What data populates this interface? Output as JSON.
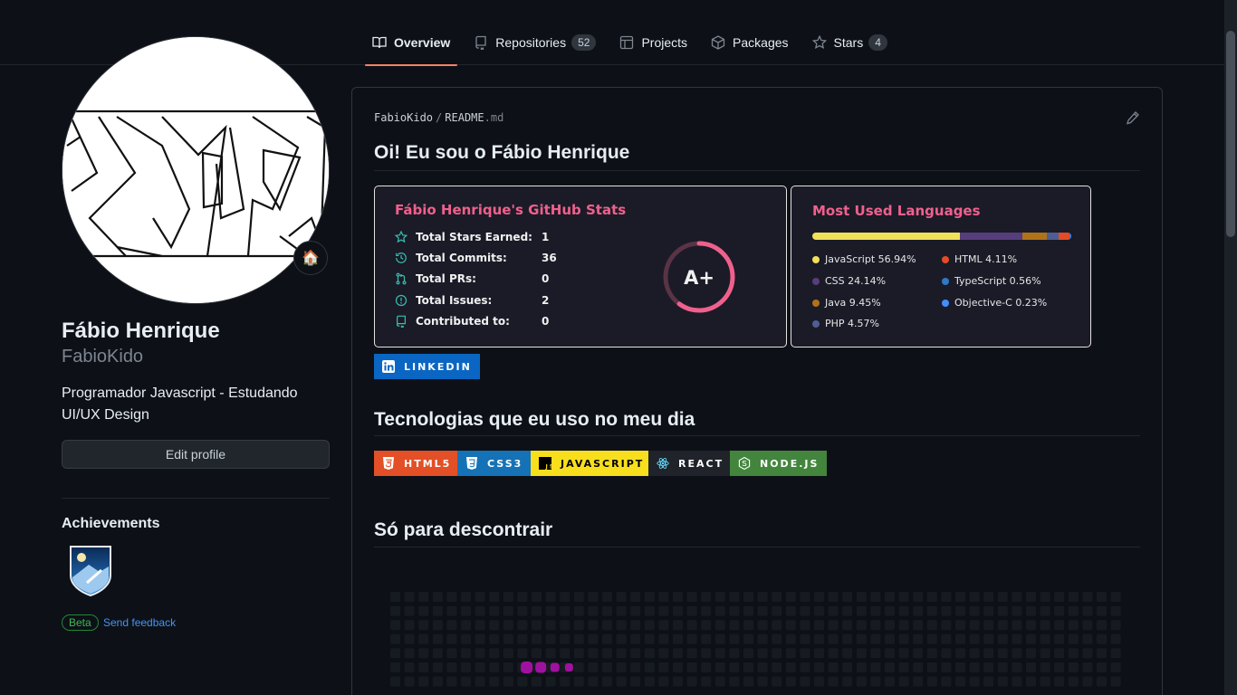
{
  "nav": {
    "tabs": [
      {
        "label": "Overview",
        "icon": "book-icon"
      },
      {
        "label": "Repositories",
        "icon": "repo-icon",
        "count": "52"
      },
      {
        "label": "Projects",
        "icon": "table-icon"
      },
      {
        "label": "Packages",
        "icon": "package-icon"
      },
      {
        "label": "Stars",
        "icon": "star-icon",
        "count": "4"
      }
    ]
  },
  "profile": {
    "name": "Fábio Henrique",
    "login": "FabioKido",
    "bio": "Programador Javascript - Estudando UI/UX Design",
    "status_emoji": "🏠",
    "edit_label": "Edit profile",
    "achievements_title": "Achievements",
    "beta_label": "Beta",
    "feedback_label": "Send feedback"
  },
  "readme": {
    "owner": "FabioKido",
    "sep": "/",
    "file": "README",
    "ext": ".md",
    "heading1": "Oi! Eu sou o Fábio Henrique",
    "heading2": "Tecnologias que eu uso no meu dia",
    "heading3": "Só para descontrair"
  },
  "stats_card": {
    "title": "Fábio Henrique's GitHub Stats",
    "rows": [
      {
        "label": "Total Stars Earned:",
        "value": "1",
        "icon": "star-outline-icon"
      },
      {
        "label": "Total Commits:",
        "value": "36",
        "icon": "history-icon"
      },
      {
        "label": "Total PRs:",
        "value": "0",
        "icon": "pull-request-icon"
      },
      {
        "label": "Total Issues:",
        "value": "2",
        "icon": "issue-icon"
      },
      {
        "label": "Contributed to:",
        "value": "0",
        "icon": "repo-icon"
      }
    ],
    "grade": "A+",
    "grade_fraction": 0.6,
    "title_color": "#f0608c",
    "icon_color": "#38bdae"
  },
  "langs_card": {
    "title": "Most Used Languages",
    "languages": [
      {
        "name": "JavaScript",
        "percent": "56.94%",
        "value": 56.94,
        "color": "#f1e05a"
      },
      {
        "name": "CSS",
        "percent": "24.14%",
        "value": 24.14,
        "color": "#563d7c"
      },
      {
        "name": "Java",
        "percent": "9.45%",
        "value": 9.45,
        "color": "#b07219"
      },
      {
        "name": "PHP",
        "percent": "4.57%",
        "value": 4.57,
        "color": "#4F5D95"
      },
      {
        "name": "HTML",
        "percent": "4.11%",
        "value": 4.11,
        "color": "#e34c26"
      },
      {
        "name": "TypeScript",
        "percent": "0.56%",
        "value": 0.56,
        "color": "#3178c6"
      },
      {
        "name": "Objective-C",
        "percent": "0.23%",
        "value": 0.23,
        "color": "#438eff"
      }
    ]
  },
  "badges": {
    "linkedin": "LINKEDIN",
    "tech": [
      {
        "label": "HTML5",
        "bg": "#e34f26",
        "fg": "#ffffff",
        "icon": "html5-icon"
      },
      {
        "label": "CSS3",
        "bg": "#1572b6",
        "fg": "#ffffff",
        "icon": "css3-icon"
      },
      {
        "label": "JAVASCRIPT",
        "bg": "#f7df1e",
        "fg": "#000000",
        "icon": "javascript-icon"
      },
      {
        "label": "REACT",
        "bg": "#20232a",
        "fg": "#ffffff",
        "icon": "react-icon"
      },
      {
        "label": "NODE.JS",
        "bg": "#43853d",
        "fg": "#ffffff",
        "icon": "nodejs-icon"
      }
    ]
  },
  "colors": {
    "accent_underline": "#f78166",
    "link": "#4493f8",
    "background": "#0d1117"
  }
}
